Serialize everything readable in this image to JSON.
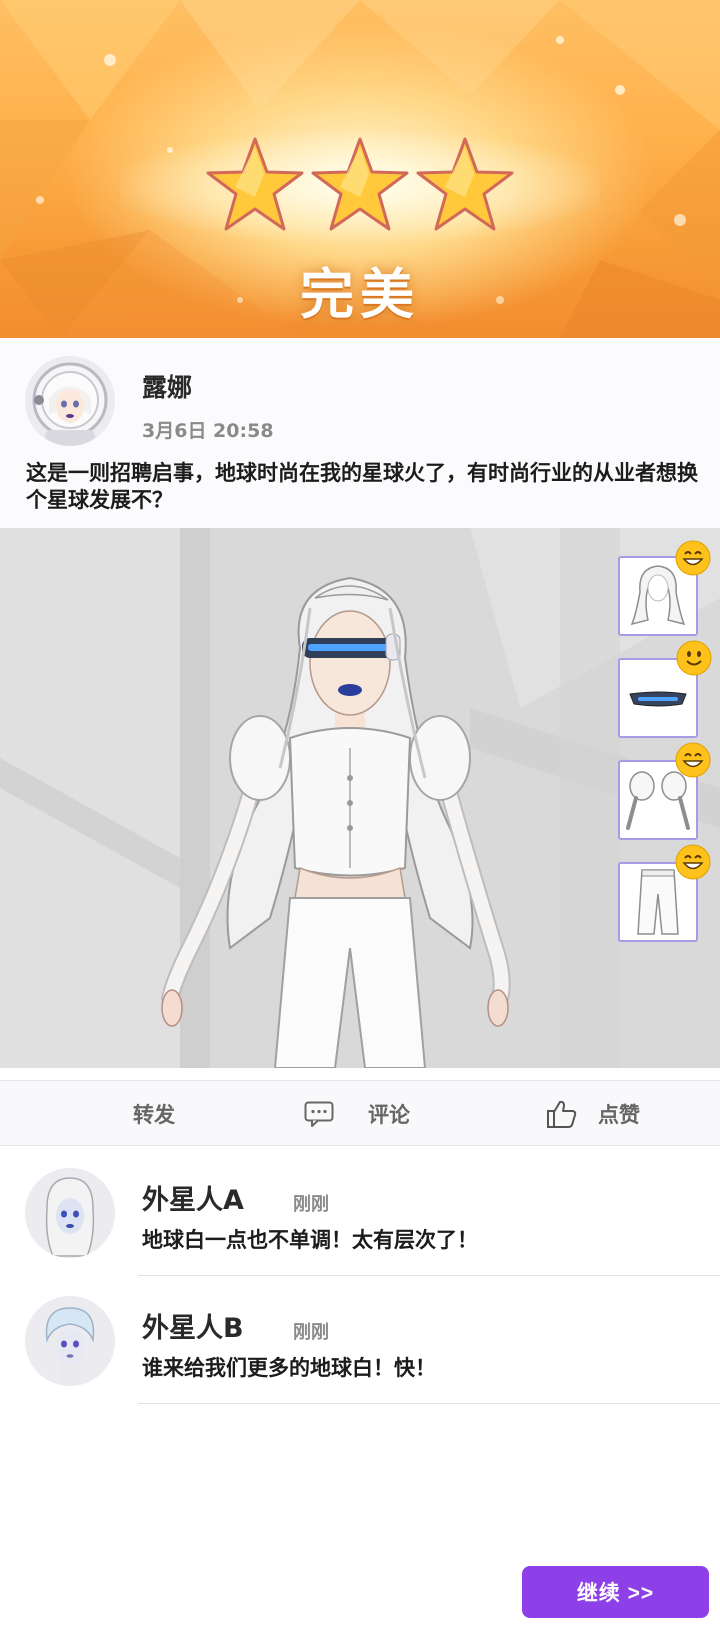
{
  "result": {
    "stars_earned": 3,
    "stars_total": 3,
    "rating_text": "完美"
  },
  "post": {
    "author": "露娜",
    "time": "3月6日 20:58",
    "text": "这是一则招聘启事，地球时尚在我的星球火了，有时尚行业的从业者想换个星球发展不？"
  },
  "items": [
    {
      "icon": "hair-icon",
      "reaction": "grin-smiley-icon"
    },
    {
      "icon": "visor-glasses-icon",
      "reaction": "smile-smiley-icon"
    },
    {
      "icon": "puff-sleeves-icon",
      "reaction": "grin-smiley-icon"
    },
    {
      "icon": "white-pants-icon",
      "reaction": "grin-smiley-icon"
    }
  ],
  "actions": {
    "share": "转发",
    "comment": "评论",
    "like": "点赞"
  },
  "comments": [
    {
      "name": "外星人A",
      "time": "刚刚",
      "text": "地球白一点也不单调！太有层次了！"
    },
    {
      "name": "外星人B",
      "time": "刚刚",
      "text": "谁来给我们更多的地球白！快！"
    }
  ],
  "continue_label": "继续 >>",
  "colors": {
    "accent_purple": "#8d3fe8",
    "card_border": "#a69be6",
    "banner_orange": "#f79a36"
  }
}
